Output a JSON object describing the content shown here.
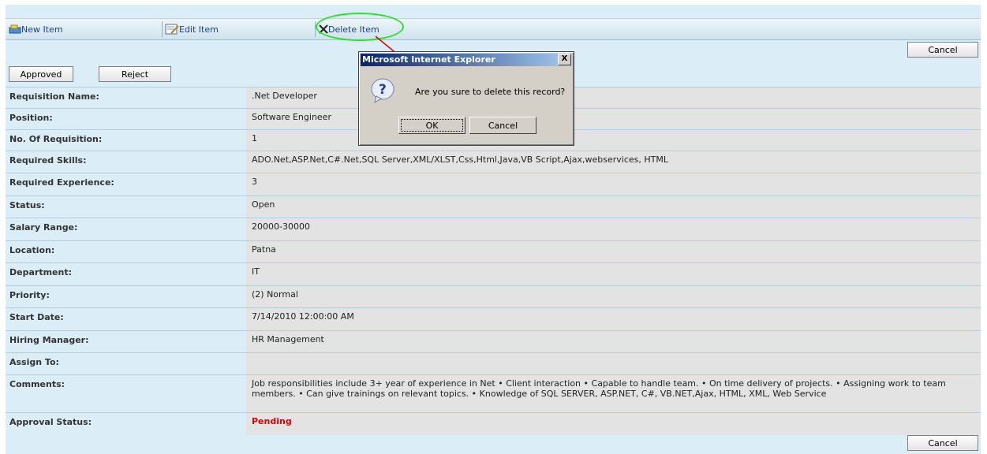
{
  "toolbar": {
    "new_item": "New Item",
    "edit_item": "Edit Item",
    "delete_item": "Delete Item"
  },
  "buttons": {
    "cancel_top": "Cancel",
    "cancel_bottom": "Cancel",
    "approved": "Approved",
    "reject": "Reject"
  },
  "fields": [
    {
      "label": "Requisition Name:",
      "value": ".Net Developer"
    },
    {
      "label": "Position:",
      "value": "Software Engineer"
    },
    {
      "label": "No. Of Requisition:",
      "value": "1"
    },
    {
      "label": "Required Skills:",
      "value": "ADO.Net,ASP.Net,C#.Net,SQL Server,XML/XLST,Css,Html,Java,VB Script,Ajax,webservices, HTML"
    },
    {
      "label": "Required Experience:",
      "value": "3"
    },
    {
      "label": "Status:",
      "value": "Open"
    },
    {
      "label": "Salary Range:",
      "value": "20000-30000"
    },
    {
      "label": "Location:",
      "value": "Patna"
    },
    {
      "label": "Department:",
      "value": "IT"
    },
    {
      "label": "Priority:",
      "value": "(2) Normal"
    },
    {
      "label": "Start Date:",
      "value": "7/14/2010 12:00:00 AM"
    },
    {
      "label": "Hiring Manager:",
      "value": "HR Management"
    },
    {
      "label": "Assign To:",
      "value": ""
    },
    {
      "label": "Comments:",
      "value": "Job responsibilities include 3+ year of experience in Net • Client interaction • Capable to handle team. • On time delivery of projects. • Assigning work to team members. • Can give trainings on relevant topics. • Knowledge of SQL SERVER, ASP.NET, C#, VB.NET,Ajax, HTML, XML, Web Service"
    },
    {
      "label": "Approval Status:",
      "value": "Pending"
    }
  ],
  "dialog": {
    "title": "Microsoft Internet Explorer",
    "message": "Are you sure to delete this record?",
    "ok": "OK",
    "cancel": "Cancel",
    "close": "X"
  },
  "colors": {
    "page_bg": "#dbeef7",
    "value_bg": "#e3e3e3",
    "pending": "#e00000",
    "highlight": "#2ee02e",
    "arrow": "#e00000"
  }
}
